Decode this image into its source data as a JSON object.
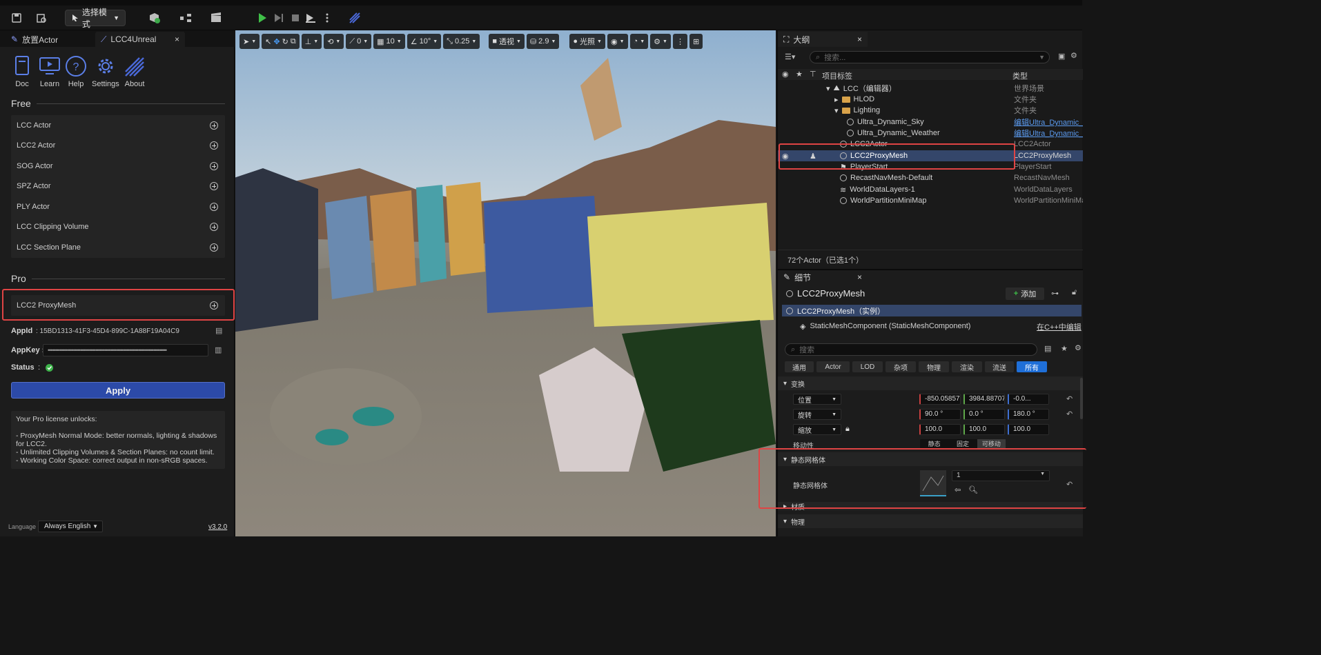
{
  "toolbar": {
    "mode_label": "选择模式"
  },
  "left_panel": {
    "tabs": [
      {
        "label": "放置Actor"
      },
      {
        "label": "LCC4Unreal"
      }
    ],
    "icons": [
      {
        "label": "Doc",
        "icon": "doc-icon"
      },
      {
        "label": "Learn",
        "icon": "monitor-icon"
      },
      {
        "label": "Help",
        "icon": "help-icon"
      },
      {
        "label": "Settings",
        "icon": "gear-icon"
      },
      {
        "label": "About",
        "icon": "logo-icon"
      }
    ],
    "free_heading": "Free",
    "free_items": [
      "LCC Actor",
      "LCC2 Actor",
      "SOG Actor",
      "SPZ Actor",
      "PLY Actor",
      "LCC Clipping Volume",
      "LCC Section Plane"
    ],
    "pro_heading": "Pro",
    "pro_items": [
      "LCC2 ProxyMesh"
    ],
    "appid_label": "AppId",
    "appid_value": ":  15BD1313-41F3-45D4-899C-1A88F19A04C9",
    "appkey_label": "AppKey :",
    "appkey_value": "••••••••••••••••••••••••••••••••••••••••••••••••••••••••••••••••••••••••••••••••",
    "status_label": "Status",
    "status_sep": ":",
    "status_color": "#3db34a",
    "apply_label": "Apply",
    "pro_info_lines": [
      "Your Pro license unlocks:",
      "",
      "- ProxyMesh Normal Mode: better normals, lighting & shadows for LCC2.",
      "- Unlimited Clipping Volumes & Section Planes: no count limit.",
      "- Working Color Space: correct output in non-sRGB spaces."
    ],
    "language_label": "Language",
    "language_value": "Always English",
    "version": "v3.2.0"
  },
  "viewport": {
    "snap_values": [
      "0",
      "10",
      "10°",
      "0.25"
    ],
    "view_mode": "透视",
    "camera_speed": "2.9",
    "lighting": "光照"
  },
  "outliner": {
    "tab_label": "大纲",
    "search_placeholder": "搜索...",
    "col_label": "项目标签",
    "col_type": "类型",
    "rows": [
      {
        "name": "LCC（编辑器）",
        "type": "世界场景"
      },
      {
        "name": "HLOD",
        "type": "文件夹"
      },
      {
        "name": "Lighting",
        "type": "文件夹"
      },
      {
        "name": "Ultra_Dynamic_Sky",
        "type": "编辑Ultra_Dynamic_Sky"
      },
      {
        "name": "Ultra_Dynamic_Weather",
        "type": "编辑Ultra_Dynamic_Weather"
      },
      {
        "name": "LCC2Actor",
        "type": "LCC2Actor"
      },
      {
        "name": "LCC2ProxyMesh",
        "type": "LCC2ProxyMesh"
      },
      {
        "name": "PlayerStart",
        "type": "PlayerStart"
      },
      {
        "name": "RecastNavMesh-Default",
        "type": "RecastNavMesh"
      },
      {
        "name": "WorldDataLayers-1",
        "type": "WorldDataLayers"
      },
      {
        "name": "WorldPartitionMiniMap",
        "type": "WorldPartitionMiniMap"
      }
    ],
    "selected_index": 6,
    "actor_count": "72个Actor（已选1个）"
  },
  "details": {
    "tab_label": "细节",
    "object_name": "LCC2ProxyMesh",
    "add_label": "添加",
    "instance_label": "LCC2ProxyMesh（实例）",
    "component_label": "StaticMeshComponent (StaticMeshComponent)",
    "cpp_link": "在C++中编辑",
    "search_placeholder": "搜索",
    "categories": [
      "通用",
      "Actor",
      "LOD",
      "杂项",
      "物理",
      "渲染",
      "流送",
      "所有"
    ],
    "active_category": "所有",
    "transform_heading": "变换",
    "location_label": "位置",
    "location_values": [
      "-850.058570",
      "3984.887070",
      "-0.0..."
    ],
    "rotation_label": "旋转",
    "rotation_values": [
      "90.0 °",
      "0.0 °",
      "180.0 °"
    ],
    "scale_label": "缩放",
    "scale_values": [
      "100.0",
      "100.0",
      "100.0"
    ],
    "mobility_label": "移动性",
    "mobility_options": [
      "静态",
      "固定",
      "可移动"
    ],
    "static_mesh_heading": "静态网格体",
    "static_mesh_label": "静态网格体",
    "static_mesh_value": "1",
    "material_heading": "材质",
    "physics_heading": "物理"
  }
}
